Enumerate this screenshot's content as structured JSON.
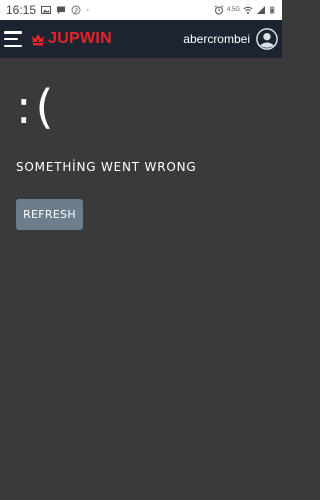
{
  "status_bar": {
    "time": "16:15",
    "network_label": "4.5G",
    "colors": {
      "background": "#ffffff",
      "text": "#444444"
    },
    "icons": [
      "image-icon",
      "message-icon",
      "pinterest-icon",
      "dot-icon",
      "alarm-icon",
      "wifi-icon",
      "signal-icon",
      "battery-icon"
    ]
  },
  "header": {
    "logo_text": "JUPWIN",
    "username": "abercrombei",
    "colors": {
      "background": "#1b2430",
      "logo": "#e5242a"
    },
    "icons": [
      "menu-icon",
      "logo-crown-icon",
      "user-avatar-icon"
    ]
  },
  "main": {
    "sad_face": ":(",
    "message": "SOMETHİNG WENT WRONG",
    "refresh_label": "REFRESH",
    "colors": {
      "background": "#3a3a3a",
      "button": "#6c7d8c"
    }
  }
}
